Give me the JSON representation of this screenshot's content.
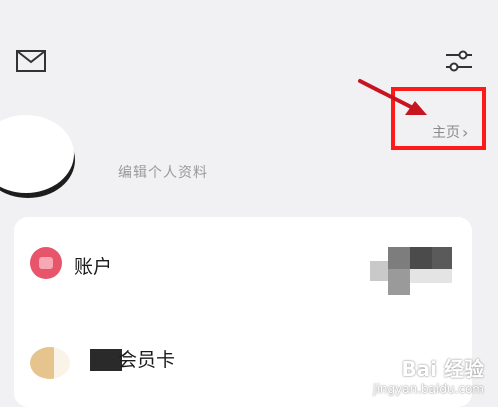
{
  "header": {
    "mail_icon": "mail-icon",
    "settings_icon": "sliders-icon"
  },
  "profile": {
    "edit_profile_label": "编辑个人资料",
    "homepage_label": "主页",
    "homepage_chevron": "›"
  },
  "menu": {
    "items": [
      {
        "label": "账户",
        "icon": "account-card-icon",
        "icon_color": "#e8546a"
      },
      {
        "label": "会员卡",
        "icon": "vip-card-icon",
        "icon_color": "#e6c48d"
      }
    ]
  },
  "annotation": {
    "color": "#ff1a1a"
  },
  "watermark": {
    "main": "Bai 经验",
    "sub": "jingyan.baidu.com"
  }
}
